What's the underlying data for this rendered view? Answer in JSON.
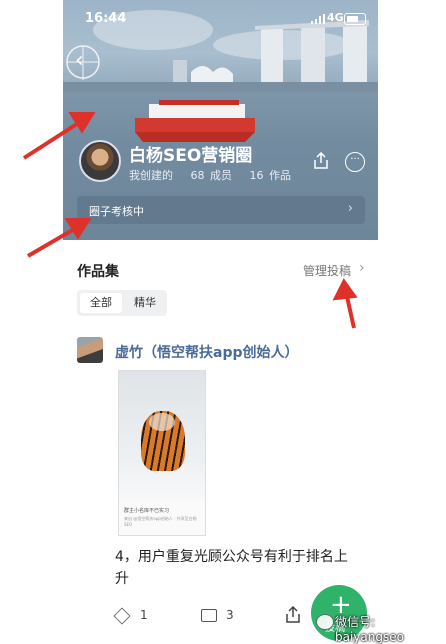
{
  "status_bar": {
    "time": "16:44",
    "network": "4G"
  },
  "community": {
    "name": "白杨SEO营销圈",
    "role": "我创建的",
    "members": "68 成员",
    "works": "16 作品",
    "review_status": "圈子考核中"
  },
  "works_section": {
    "title": "作品集",
    "manage_label": "管理投稿",
    "tabs": [
      {
        "label": "全部"
      },
      {
        "label": "精华"
      }
    ]
  },
  "post": {
    "author": "虚竹（悟空帮扶app创始人）",
    "image_caption": "群主小名库不已实习",
    "image_subcaption": "来自 @悟空帮扶app创始人 · 共享至白杨SEO",
    "title": "4，用户重复光顾公众号有利于排名上升",
    "likes": "1",
    "comments": "3"
  },
  "fab": {
    "label": "投稿"
  },
  "watermark": "微信号: baiyangseo",
  "colors": {
    "accent_green": "#2fb36a",
    "arrow_red": "#e0302a",
    "link_blue": "#4a6a9a"
  },
  "icons": [
    "back-icon",
    "share-icon",
    "more-icon",
    "chevron-right-icon",
    "cube-icon",
    "comment-icon",
    "plus-icon",
    "wechat-icon"
  ]
}
